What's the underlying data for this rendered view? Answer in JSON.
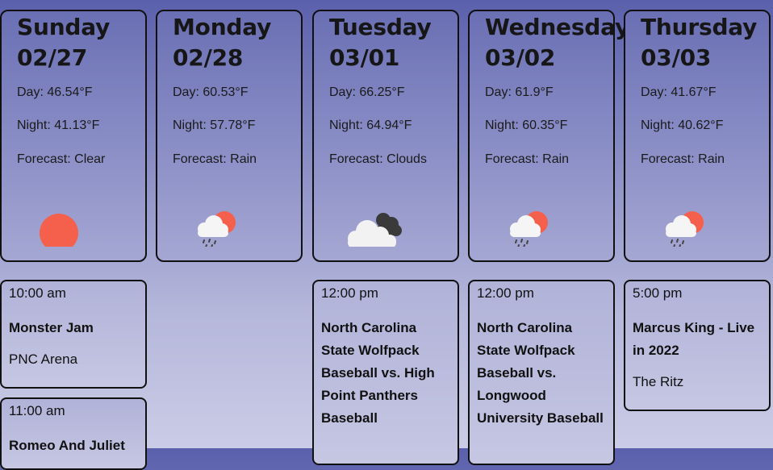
{
  "days": [
    {
      "name": "Sunday",
      "date": "02/27",
      "day": "Day: 46.54°F",
      "night": "Night: 41.13°F",
      "forecast": "Forecast: Clear",
      "icon": "sun-icon"
    },
    {
      "name": "Monday",
      "date": "02/28",
      "day": "Day: 60.53°F",
      "night": "Night: 57.78°F",
      "forecast": "Forecast: Rain",
      "icon": "rain-icon"
    },
    {
      "name": "Tuesday",
      "date": "03/01",
      "day": "Day: 66.25°F",
      "night": "Night: 64.94°F",
      "forecast": "Forecast: Clouds",
      "icon": "clouds-icon"
    },
    {
      "name": "Wednesday",
      "date": "03/02",
      "day": "Day: 61.9°F",
      "night": "Night: 60.35°F",
      "forecast": "Forecast: Rain",
      "icon": "rain-icon"
    },
    {
      "name": "Thursday",
      "date": "03/03",
      "day": "Day: 41.67°F",
      "night": "Night: 40.62°F",
      "forecast": "Forecast: Rain",
      "icon": "rain-icon"
    }
  ],
  "events": {
    "sunday": [
      {
        "time": "10:00 am",
        "title": "Monster Jam",
        "venue": "PNC Arena"
      },
      {
        "time": "11:00 am",
        "title": "Romeo And Juliet",
        "venue": ""
      }
    ],
    "tuesday": [
      {
        "time": "12:00 pm",
        "title": "North Carolina State Wolfpack Baseball vs. High Point Panthers Baseball",
        "venue": ""
      }
    ],
    "wednesday": [
      {
        "time": "12:00 pm",
        "title": "North Carolina State Wolfpack Baseball vs. Longwood University Baseball",
        "venue": ""
      }
    ],
    "thursday": [
      {
        "time": "5:00 pm",
        "title": "Marcus King - Live in 2022",
        "venue": "The Ritz"
      }
    ]
  },
  "colors": {
    "sun": "#f4604c",
    "cloud_light": "#f2f2f2",
    "cloud_dark": "#3a3a3a",
    "rain": "#444444"
  }
}
